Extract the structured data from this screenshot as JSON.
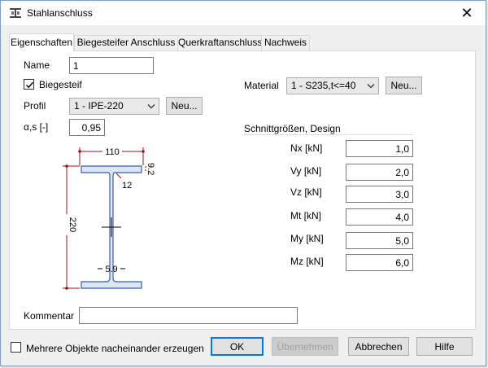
{
  "window": {
    "title": "Stahlanschluss",
    "close_glyph": "✕"
  },
  "tabs": [
    {
      "label": "Eigenschaften",
      "active": true
    },
    {
      "label": "Biegesteifer Anschluss",
      "active": false
    },
    {
      "label": "Querkraftanschluss",
      "active": false
    },
    {
      "label": "Nachweis",
      "active": false
    }
  ],
  "form": {
    "name_label": "Name",
    "name_value": "1",
    "biegesteif_label": "Biegesteif",
    "biegesteif_checked": true,
    "profil_label": "Profil",
    "profil_value": "1 - IPE-220",
    "profil_new": "Neu...",
    "alpha_label": "α,s [-]",
    "alpha_value": "0,95",
    "material_label": "Material",
    "material_value": "1 - S235,t<=40",
    "material_new": "Neu...",
    "kommentar_label": "Kommentar",
    "kommentar_value": ""
  },
  "schnitt": {
    "title": "Schnittgrößen, Design",
    "rows": [
      {
        "label": "Nx [kN]",
        "value": "1,0"
      },
      {
        "label": "Vy [kN]",
        "value": "2,0"
      },
      {
        "label": "Vz [kN]",
        "value": "3,0"
      },
      {
        "label": "Mt [kN]",
        "value": "4,0"
      },
      {
        "label": "My [kN]",
        "value": "5,0"
      },
      {
        "label": "Mz [kN]",
        "value": "6,0"
      }
    ]
  },
  "profile_drawing": {
    "width_label": "110",
    "height_label": "220",
    "flange_label": "9.2",
    "radius_label": "12",
    "web_label": "5.9"
  },
  "footer": {
    "multi_label": "Mehrere Objekte nacheinander erzeugen",
    "multi_checked": false,
    "ok": "OK",
    "apply": "Übernehmen",
    "cancel": "Abbrechen",
    "help": "Hilfe"
  },
  "colors": {
    "accent": "#0078d7",
    "dimension": "#8b1a1a",
    "profile_fill": "#dde6f3",
    "profile_stroke": "#3b5fa8"
  }
}
